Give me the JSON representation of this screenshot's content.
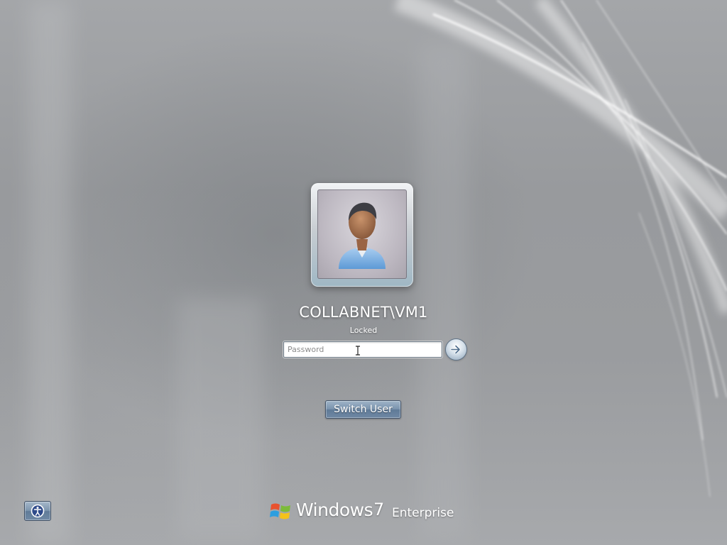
{
  "user": {
    "name": "COLLABNET\\VM1",
    "status": "Locked",
    "avatar_icon": "user-avatar-icon"
  },
  "password": {
    "value": "",
    "placeholder": "Password"
  },
  "buttons": {
    "submit_icon": "arrow-right-icon",
    "switch_user_label": "Switch User",
    "ease_of_access_icon": "ease-of-access-icon"
  },
  "branding": {
    "logo_icon": "windows-flag-icon",
    "product": "Windows",
    "version": "7",
    "edition": "Enterprise"
  },
  "colors": {
    "background": "#9c9ea1",
    "button_blue": "#6f88a4",
    "text": "#ffffff"
  }
}
